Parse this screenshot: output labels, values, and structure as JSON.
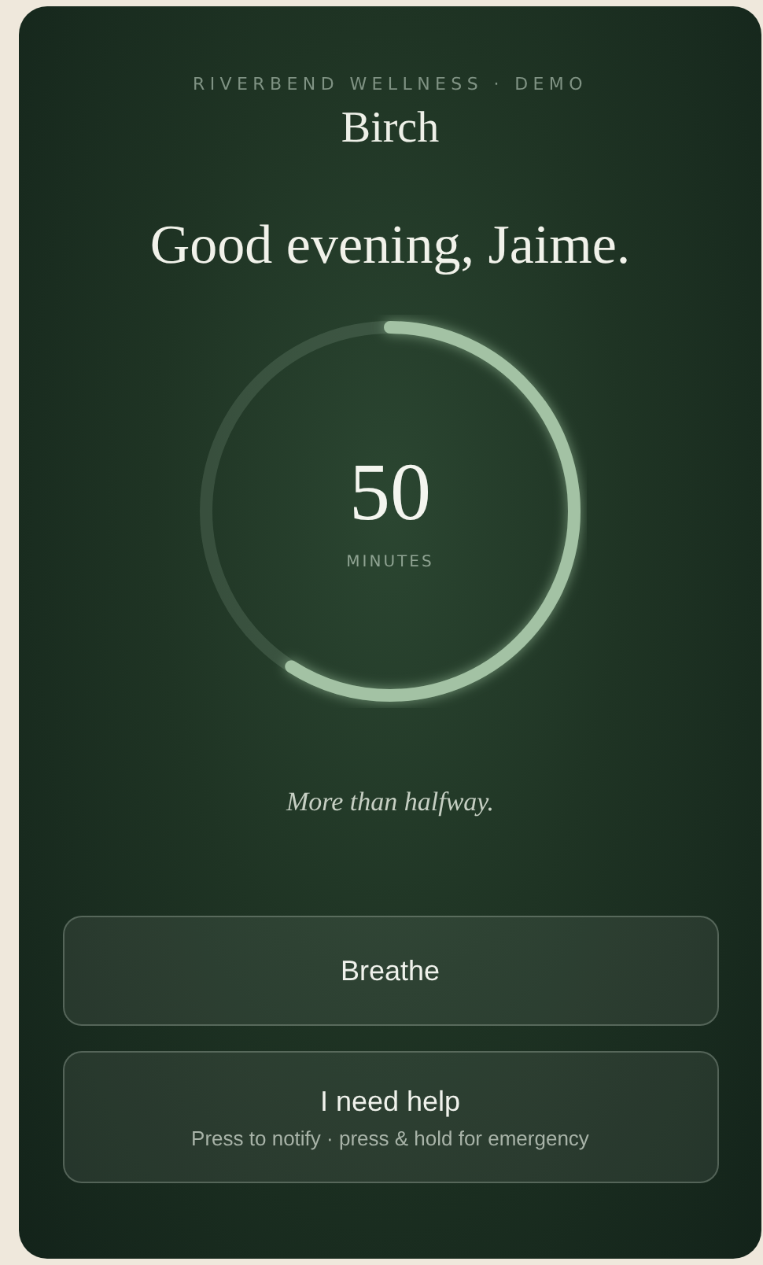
{
  "header": {
    "tagline": "RIVERBEND WELLNESS · DEMO",
    "app_name": "Birch"
  },
  "greeting": "Good evening, Jaime.",
  "timer": {
    "value": "50",
    "unit": "MINUTES",
    "level": 0.59
  },
  "status": "More than halfway.",
  "buttons": [
    {
      "label": "Breathe"
    },
    {
      "label": "I need help",
      "subtitle": "Press to notify · press & hold for emergency"
    }
  ]
}
